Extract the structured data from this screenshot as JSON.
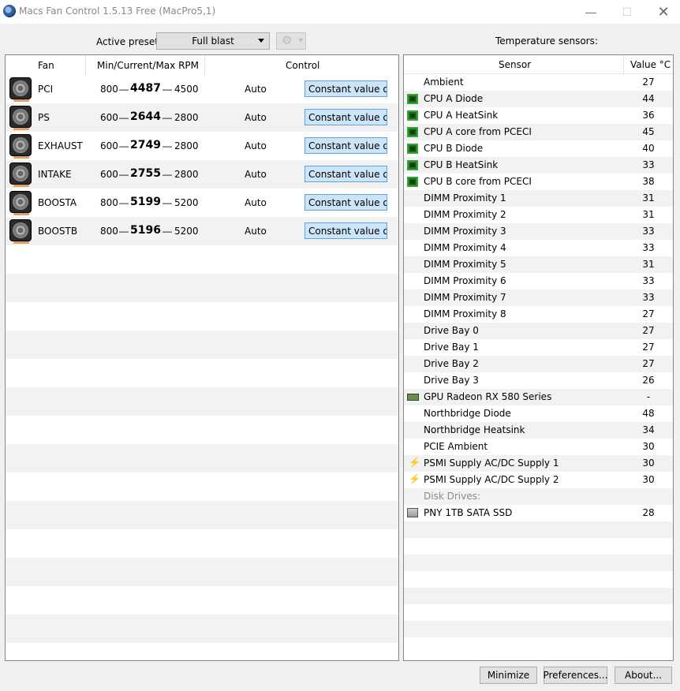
{
  "window": {
    "title": "Macs Fan Control 1.5.13 Free (MacPro5,1)",
    "minimize_glyph": "—",
    "maximize_glyph": "☐",
    "close_glyph": "✕"
  },
  "preset": {
    "label": "Active preset:",
    "value": "Full blast",
    "gear_glyph": "⚙",
    "gear_caret": "▼"
  },
  "temp_section_label": "Temperature sensors:",
  "fan_table": {
    "headers": {
      "fan": "Fan",
      "rpm": "Min/Current/Max RPM",
      "control": "Control"
    },
    "dash": "—",
    "rows": [
      {
        "name": "PCI",
        "min": "800",
        "current": "4487",
        "max": "4500",
        "mode": "Auto",
        "control": "Constant value o..."
      },
      {
        "name": "PS",
        "min": "600",
        "current": "2644",
        "max": "2800",
        "mode": "Auto",
        "control": "Constant value o..."
      },
      {
        "name": "EXHAUST",
        "min": "600",
        "current": "2749",
        "max": "2800",
        "mode": "Auto",
        "control": "Constant value o..."
      },
      {
        "name": "INTAKE",
        "min": "600",
        "current": "2755",
        "max": "2800",
        "mode": "Auto",
        "control": "Constant value o..."
      },
      {
        "name": "BOOSTA",
        "min": "800",
        "current": "5199",
        "max": "5200",
        "mode": "Auto",
        "control": "Constant value o..."
      },
      {
        "name": "BOOSTB",
        "min": "800",
        "current": "5196",
        "max": "5200",
        "mode": "Auto",
        "control": "Constant value o..."
      }
    ]
  },
  "sensor_table": {
    "headers": {
      "sensor": "Sensor",
      "value": "Value °C"
    },
    "rows": [
      {
        "icon": "",
        "name": "Ambient",
        "value": "27"
      },
      {
        "icon": "chip-icon",
        "name": "CPU A Diode",
        "value": "44"
      },
      {
        "icon": "chip-icon",
        "name": "CPU A HeatSink",
        "value": "36"
      },
      {
        "icon": "chip-icon",
        "name": "CPU A core from PCECI",
        "value": "45"
      },
      {
        "icon": "chip-icon",
        "name": "CPU B Diode",
        "value": "40"
      },
      {
        "icon": "chip-icon",
        "name": "CPU B HeatSink",
        "value": "33"
      },
      {
        "icon": "chip-icon",
        "name": "CPU B core from PCECI",
        "value": "38"
      },
      {
        "icon": "",
        "name": "DIMM Proximity 1",
        "value": "31"
      },
      {
        "icon": "",
        "name": "DIMM Proximity 2",
        "value": "31"
      },
      {
        "icon": "",
        "name": "DIMM Proximity 3",
        "value": "33"
      },
      {
        "icon": "",
        "name": "DIMM Proximity 4",
        "value": "33"
      },
      {
        "icon": "",
        "name": "DIMM Proximity 5",
        "value": "31"
      },
      {
        "icon": "",
        "name": "DIMM Proximity 6",
        "value": "33"
      },
      {
        "icon": "",
        "name": "DIMM Proximity 7",
        "value": "33"
      },
      {
        "icon": "",
        "name": "DIMM Proximity 8",
        "value": "27"
      },
      {
        "icon": "",
        "name": "Drive Bay 0",
        "value": "27"
      },
      {
        "icon": "",
        "name": "Drive Bay 1",
        "value": "27"
      },
      {
        "icon": "",
        "name": "Drive Bay 2",
        "value": "27"
      },
      {
        "icon": "",
        "name": "Drive Bay 3",
        "value": "26"
      },
      {
        "icon": "gpu-icon",
        "name": "GPU Radeon RX 580 Series",
        "value": "-"
      },
      {
        "icon": "",
        "name": "Northbridge Diode",
        "value": "48"
      },
      {
        "icon": "",
        "name": "Northbridge Heatsink",
        "value": "34"
      },
      {
        "icon": "",
        "name": "PCIE Ambient",
        "value": "30"
      },
      {
        "icon": "bolt-icon",
        "name": "PSMI Supply AC/DC Supply 1",
        "value": "30"
      },
      {
        "icon": "bolt-icon",
        "name": "PSMI Supply AC/DC Supply 2",
        "value": "30"
      },
      {
        "icon": "",
        "name": "Disk Drives:",
        "value": "",
        "group": true
      },
      {
        "icon": "disk-icon",
        "name": "PNY 1TB SATA SSD",
        "value": "28"
      }
    ]
  },
  "buttons": {
    "minimize": "Minimize",
    "preferences": "Preferences...",
    "about": "About..."
  }
}
